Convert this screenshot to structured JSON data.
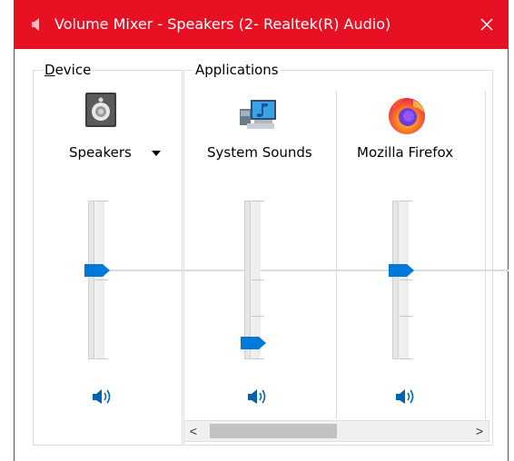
{
  "window": {
    "title": "Volume Mixer - Speakers (2- Realtek(R) Audio)",
    "accent_color": "#e81123",
    "close_icon": "close-icon",
    "title_icon": "speaker-icon"
  },
  "device_group": {
    "label": "Device",
    "mnemonic_underline": "D",
    "device": {
      "name": "Speakers",
      "icon": "speaker-device-icon",
      "has_dropdown": true,
      "volume_level": 0.58,
      "mute_icon": "volume-icon"
    }
  },
  "applications_group": {
    "label": "Applications",
    "apps": [
      {
        "name": "System Sounds",
        "icon": "system-sounds-icon",
        "volume_level": 0.1,
        "mute_icon": "volume-icon"
      },
      {
        "name": "Mozilla Firefox",
        "icon": "firefox-icon",
        "volume_level": 0.58,
        "mute_icon": "volume-icon"
      }
    ]
  },
  "slider_colors": {
    "thumb": "#0078d7",
    "track": "#e6e6e6"
  },
  "scrollbar": {
    "left_arrow": "<",
    "right_arrow": ">"
  }
}
